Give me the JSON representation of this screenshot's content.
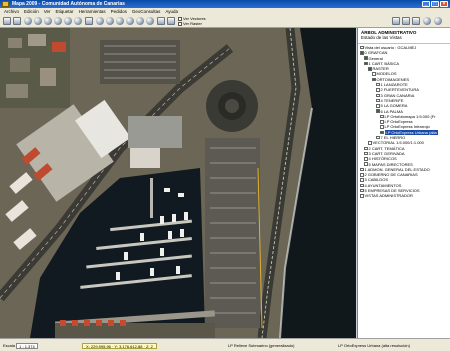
{
  "window": {
    "title": "Mapa 2009 - Comunidad Autónoma de Canarias"
  },
  "menu": [
    "Archivo",
    "Edición",
    "Ver",
    "Etiquetar",
    "Herramientas",
    "Pedidos",
    "GeoConsultas",
    "Ayuda"
  ],
  "toolbar": {
    "ver_vectores": "Ver Vectores",
    "ver_raster": "Ver Raster"
  },
  "panel": {
    "title": "ÁRBOL ADMINISTRATIVO",
    "subtitle": "Estado de las Vistas",
    "items": [
      {
        "label": "Vista del usuario : GCALMEJ",
        "indent": 0,
        "checked": false,
        "selected": false
      },
      {
        "label": "0 GRAFCAN",
        "indent": 0,
        "checked": true,
        "selected": false
      },
      {
        "label": "General",
        "indent": 1,
        "checked": true,
        "selected": false
      },
      {
        "label": "1 CART. BÁSICA",
        "indent": 1,
        "checked": true,
        "selected": false
      },
      {
        "label": "RASTER",
        "indent": 2,
        "checked": true,
        "selected": false
      },
      {
        "label": "MODELOS",
        "indent": 3,
        "checked": false,
        "selected": false
      },
      {
        "label": "ORTOIMAGENES",
        "indent": 3,
        "checked": true,
        "selected": false
      },
      {
        "label": "1 LANZAROTE",
        "indent": 4,
        "checked": false,
        "selected": false
      },
      {
        "label": "2 FUERTEVENTURA",
        "indent": 4,
        "checked": false,
        "selected": false
      },
      {
        "label": "3 GRAN CANARIA",
        "indent": 4,
        "checked": false,
        "selected": false
      },
      {
        "label": "4 TENERIFE",
        "indent": 4,
        "checked": false,
        "selected": false
      },
      {
        "label": "5 LA GOMERA",
        "indent": 4,
        "checked": false,
        "selected": false
      },
      {
        "label": "6 LA PALMA",
        "indent": 4,
        "checked": true,
        "selected": false
      },
      {
        "label": "LP Ortofotomapa 1:5.000 (Fr",
        "indent": 5,
        "checked": false,
        "selected": false
      },
      {
        "label": "LP OrtoExpress",
        "indent": 5,
        "checked": false,
        "selected": false
      },
      {
        "label": "LP OrtoExpress Infrarrojo",
        "indent": 5,
        "checked": false,
        "selected": false
      },
      {
        "label": "LP OrtoExpress Urbana (alta",
        "indent": 5,
        "checked": true,
        "selected": true
      },
      {
        "label": "7 EL HIERRO",
        "indent": 4,
        "checked": false,
        "selected": false
      },
      {
        "label": "VECTORIAL 1:5.000/1:1.000",
        "indent": 2,
        "checked": false,
        "selected": false
      },
      {
        "label": "2 CART. TEMÁTICA",
        "indent": 1,
        "checked": false,
        "selected": false
      },
      {
        "label": "3 CART. DERIVADA",
        "indent": 1,
        "checked": false,
        "selected": false
      },
      {
        "label": "4 HISTÓRICOS",
        "indent": 1,
        "checked": false,
        "selected": false
      },
      {
        "label": "5 MAPAS DIRECTORES",
        "indent": 1,
        "checked": false,
        "selected": false
      },
      {
        "label": "1 ADMON. GENERAL DEL ESTADO",
        "indent": 0,
        "checked": false,
        "selected": false
      },
      {
        "label": "2 GOBIERNO DE CANARIAS",
        "indent": 0,
        "checked": false,
        "selected": false
      },
      {
        "label": "3 CABILDOS",
        "indent": 0,
        "checked": false,
        "selected": false
      },
      {
        "label": "4 AYUNTAMIENTOS",
        "indent": 0,
        "checked": false,
        "selected": false
      },
      {
        "label": "5 EMPRESAS DE SERVICIOS",
        "indent": 0,
        "checked": false,
        "selected": false
      },
      {
        "label": "VISTAS ADMINISTRADOR",
        "indent": 0,
        "checked": false,
        "selected": false
      }
    ]
  },
  "status": {
    "scale_label": "Escala",
    "scale_value": "1 : 1.374",
    "coords": "X: 229.995,96 · Y: 3.176.612,88 · Z: 2",
    "layer1": "LP Relieve Submarino (generalizado)",
    "layer2": "LP OrtoExpress Urbana (alta resolución)"
  },
  "colors": {
    "title_bar": "#0a4ba8",
    "selection": "#1a4aa8",
    "sea": "#121a1e"
  }
}
